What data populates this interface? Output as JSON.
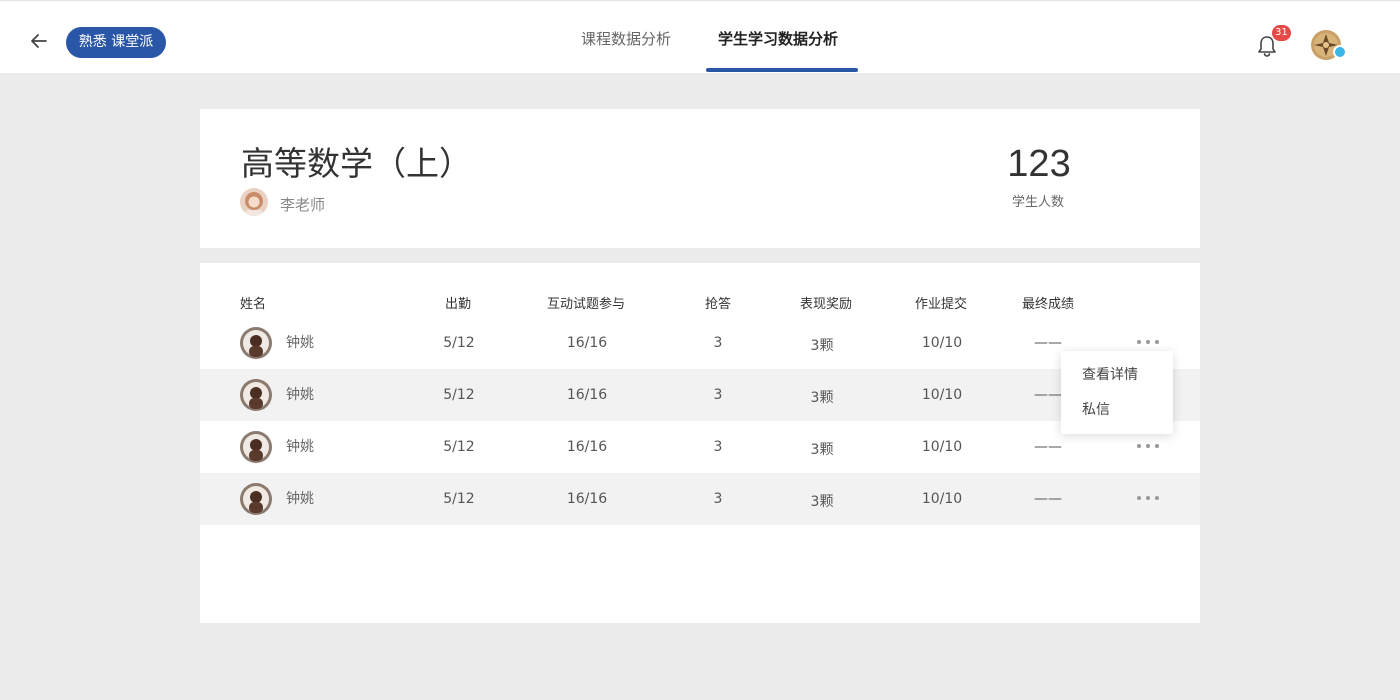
{
  "header": {
    "brand": "熟悉 课堂派",
    "tabs": [
      {
        "label": "课程数据分析",
        "active": false
      },
      {
        "label": "学生学习数据分析",
        "active": true
      }
    ],
    "notification_count": "31",
    "accent_color": "#2a56a8",
    "badge_color": "#e54a47"
  },
  "course": {
    "title": "高等数学（上）",
    "teacher": "李老师",
    "student_count": "123",
    "student_count_label": "学生人数"
  },
  "table": {
    "columns": [
      "姓名",
      "出勤",
      "互动试题参与",
      "抢答",
      "表现奖励",
      "作业提交",
      "最终成绩"
    ],
    "rows": [
      {
        "name": "钟姚",
        "attendance": "5/12",
        "interaction": "16/16",
        "answers": "3",
        "rewards": "3颗",
        "homework": "10/10",
        "grade": "——"
      },
      {
        "name": "钟姚",
        "attendance": "5/12",
        "interaction": "16/16",
        "answers": "3",
        "rewards": "3颗",
        "homework": "10/10",
        "grade": "——"
      },
      {
        "name": "钟姚",
        "attendance": "5/12",
        "interaction": "16/16",
        "answers": "3",
        "rewards": "3颗",
        "homework": "10/10",
        "grade": "——"
      },
      {
        "name": "钟姚",
        "attendance": "5/12",
        "interaction": "16/16",
        "answers": "3",
        "rewards": "3颗",
        "homework": "10/10",
        "grade": "——"
      }
    ]
  },
  "context_menu": {
    "items": [
      "查看详情",
      "私信"
    ]
  },
  "icons": [
    "back-arrow-icon",
    "bell-icon",
    "more-dots-icon",
    "verified-icon"
  ]
}
